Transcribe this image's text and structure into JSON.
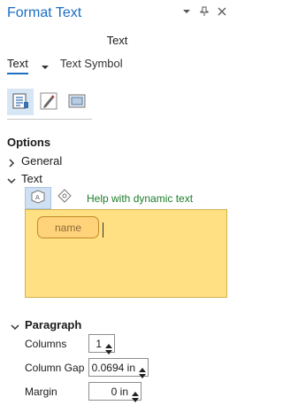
{
  "pane": {
    "title": "Format Text",
    "subtitle": "Text"
  },
  "tabs": {
    "active": "Text",
    "other": "Text Symbol"
  },
  "options": {
    "heading": "Options",
    "general_label": "General",
    "text_label": "Text",
    "help_link": "Help with dynamic text",
    "dynamic_chip": "name"
  },
  "paragraph": {
    "heading": "Paragraph",
    "fields": [
      {
        "label": "Columns",
        "value": "1"
      },
      {
        "label": "Column Gap",
        "value": "0.0694 in"
      },
      {
        "label": "Margin",
        "value": "0 in"
      }
    ]
  },
  "colors": {
    "accent": "#1b6ec2",
    "editor_bg": "#ffe082",
    "help_link": "#1e7d2b"
  }
}
